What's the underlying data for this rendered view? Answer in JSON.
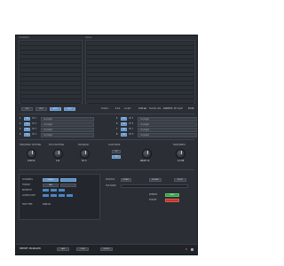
{
  "panels": {
    "left_title": "CHANNELS",
    "right_title": "TRACK"
  },
  "tabs": [
    "LIVE",
    "STEP",
    "AUTO",
    "EDIT"
  ],
  "readouts": [
    {
      "label": "Position",
      "value": "1.1.1"
    },
    {
      "label": "Length",
      "value": "0.00 sec"
    },
    {
      "label": "Sample rate",
      "value": "44100 Hz"
    },
    {
      "label": "Bit depth",
      "value": "24 bit"
    }
  ],
  "channels_left": [
    {
      "num": "1",
      "btn": "ON",
      "name": "CH 1",
      "value": "no plugin"
    },
    {
      "num": "2",
      "btn": "ON",
      "name": "CH 2",
      "value": "no plugin"
    },
    {
      "num": "3",
      "btn": "ON",
      "name": "CH 3",
      "value": "no plugin"
    },
    {
      "num": "4",
      "btn": "ON",
      "name": "CH 4",
      "value": "no plugin"
    }
  ],
  "channels_right": [
    {
      "num": "5",
      "btn": "ON",
      "name": "CH 5",
      "value": "no plugin"
    },
    {
      "num": "6",
      "btn": "ON",
      "name": "CH 6",
      "value": "no plugin"
    },
    {
      "num": "7",
      "btn": "ON",
      "name": "CH 7",
      "value": "no plugin"
    },
    {
      "num": "8",
      "btn": "ON",
      "name": "CH 8",
      "value": "no plugin"
    }
  ],
  "knobs": [
    {
      "label": "FREQUENCY SHIFTING",
      "value": "0.00 Hz"
    },
    {
      "label": "PITCH SHIFTING",
      "value": "0 st"
    },
    {
      "label": "MIX/WARM",
      "value": "50 %"
    },
    {
      "label": "DRIVE",
      "value": "DRIVE 1X"
    },
    {
      "label": "FADE/SPEED",
      "value": "0.0 dB"
    }
  ],
  "mode": {
    "label": "LOOP MODE",
    "options": [
      "OFF",
      "ON"
    ]
  },
  "controls": [
    {
      "label": "CHANNELS",
      "value": "STEREO"
    },
    {
      "label": "FORMAT",
      "value": "WAV"
    },
    {
      "label": "BITDEPTH",
      "value": "24"
    },
    {
      "label": "SAMPLE RATE",
      "value": "44.1"
    },
    {
      "label": "FADE TIME",
      "value": "0.00 ms"
    }
  ],
  "right_controls": {
    "row1": [
      "PROCESS",
      "BYPASS",
      "NORMAL",
      "MONO"
    ],
    "file_label": "FILE NAME",
    "action_label": "RENDER",
    "action_btn": "START",
    "export_label": "EXPORT"
  },
  "footer": {
    "title": "PRESET MANAGER",
    "buttons": [
      "SAVE",
      "LOAD",
      "DELETE"
    ]
  },
  "colors": {
    "accent": "#5c8fc4",
    "start": "#3aa14a",
    "record": "#c0392b",
    "bg": "#2b2f35"
  }
}
